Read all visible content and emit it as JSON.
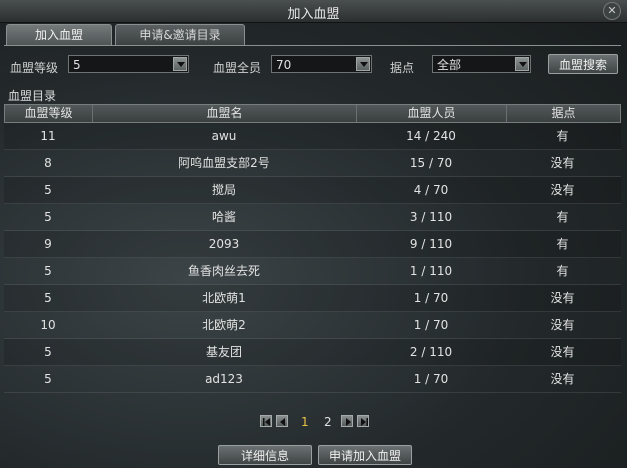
{
  "window": {
    "title": "加入血盟",
    "close_icon": "close-icon"
  },
  "tabs": [
    {
      "label": "加入血盟",
      "active": true
    },
    {
      "label": "申请&邀请目录",
      "active": false
    }
  ],
  "filters": {
    "level": {
      "label": "血盟等级",
      "value": "5"
    },
    "members": {
      "label": "血盟全员",
      "value": "70"
    },
    "base": {
      "label": "据点",
      "value": "全部"
    },
    "search_button": "血盟搜索"
  },
  "list_title": "血盟目录",
  "table": {
    "headers": [
      "血盟等级",
      "血盟名",
      "血盟人员",
      "据点"
    ],
    "rows": [
      {
        "level": "11",
        "name": "awu",
        "members": "14 / 240",
        "base": "有"
      },
      {
        "level": "8",
        "name": "阿呜血盟支部2号",
        "members": "15 / 70",
        "base": "没有"
      },
      {
        "level": "5",
        "name": "搅局",
        "members": "4 / 70",
        "base": "没有"
      },
      {
        "level": "5",
        "name": "哈酱",
        "members": "3 / 110",
        "base": "有"
      },
      {
        "level": "9",
        "name": "2093",
        "members": "9 / 110",
        "base": "有"
      },
      {
        "level": "5",
        "name": "鱼香肉丝去死",
        "members": "1 / 110",
        "base": "有"
      },
      {
        "level": "5",
        "name": "北欧萌1",
        "members": "1 / 70",
        "base": "没有"
      },
      {
        "level": "10",
        "name": "北欧萌2",
        "members": "1 / 70",
        "base": "没有"
      },
      {
        "level": "5",
        "name": "基友团",
        "members": "2 / 110",
        "base": "没有"
      },
      {
        "level": "5",
        "name": "ad123",
        "members": "1 / 70",
        "base": "没有"
      }
    ]
  },
  "pagination": {
    "pages": [
      "1",
      "2"
    ],
    "current": "1"
  },
  "footer": {
    "details_button": "详细信息",
    "apply_button": "申请加入血盟"
  },
  "colors": {
    "accent_current_page": "#e9c24a"
  }
}
